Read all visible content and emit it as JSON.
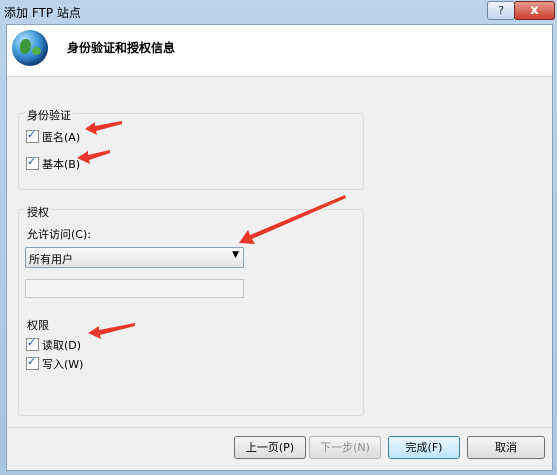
{
  "window": {
    "title": "添加 FTP 站点",
    "help_label": "?",
    "close_label": "x"
  },
  "header": {
    "title": "身份验证和授权信息"
  },
  "authentication": {
    "group_label": "身份验证",
    "anonymous": {
      "label": "匿名(A)",
      "checked": true
    },
    "basic": {
      "label": "基本(B)",
      "checked": true
    }
  },
  "authorization": {
    "group_label": "授权",
    "allow_access_label": "允许访问(C):",
    "allow_access_value": "所有用户",
    "user_text": "",
    "permissions_label": "权限",
    "read": {
      "label": "读取(D)",
      "checked": true
    },
    "write": {
      "label": "写入(W)",
      "checked": true
    }
  },
  "buttons": {
    "previous": "上一页(P)",
    "next": "下一步(N)",
    "finish": "完成(F)",
    "cancel": "取消"
  },
  "colors": {
    "annotation_arrow": "#e8372b",
    "title_bar": "#bcd3ea"
  },
  "icons": {
    "header": "globe-icon",
    "dropdown": "chevron-down-icon",
    "checkbox": "check-icon"
  }
}
